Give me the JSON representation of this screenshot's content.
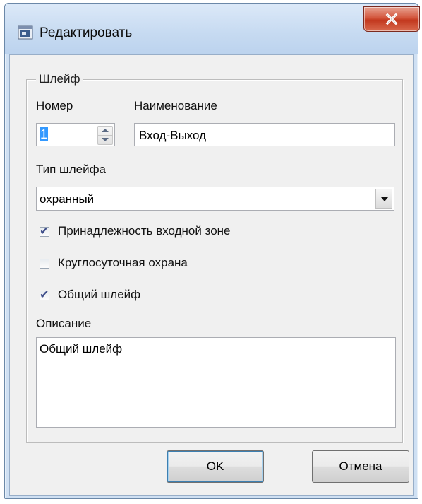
{
  "window": {
    "title": "Редактировать",
    "icon": "app-window-icon",
    "close_icon": "close-x-icon"
  },
  "group": {
    "title": "Шлейф",
    "number_label": "Номер",
    "number_value": "1",
    "name_label": "Наименование",
    "name_value": "Вход-Выход",
    "type_label": "Тип шлейфа",
    "type_value": "охранный",
    "checkboxes": [
      {
        "label": "Принадлежность входной зоне",
        "checked": true
      },
      {
        "label": "Круглосуточная охрана",
        "checked": false
      },
      {
        "label": "Общий шлейф",
        "checked": true
      }
    ],
    "description_label": "Описание",
    "description_value": "Общий шлейф"
  },
  "buttons": {
    "ok": "OK",
    "cancel": "Отмена"
  },
  "colors": {
    "title_bar": "#c6daf1",
    "close_button": "#c2381e",
    "dialog_bg": "#f0f0f0",
    "selection": "#3399ff"
  }
}
